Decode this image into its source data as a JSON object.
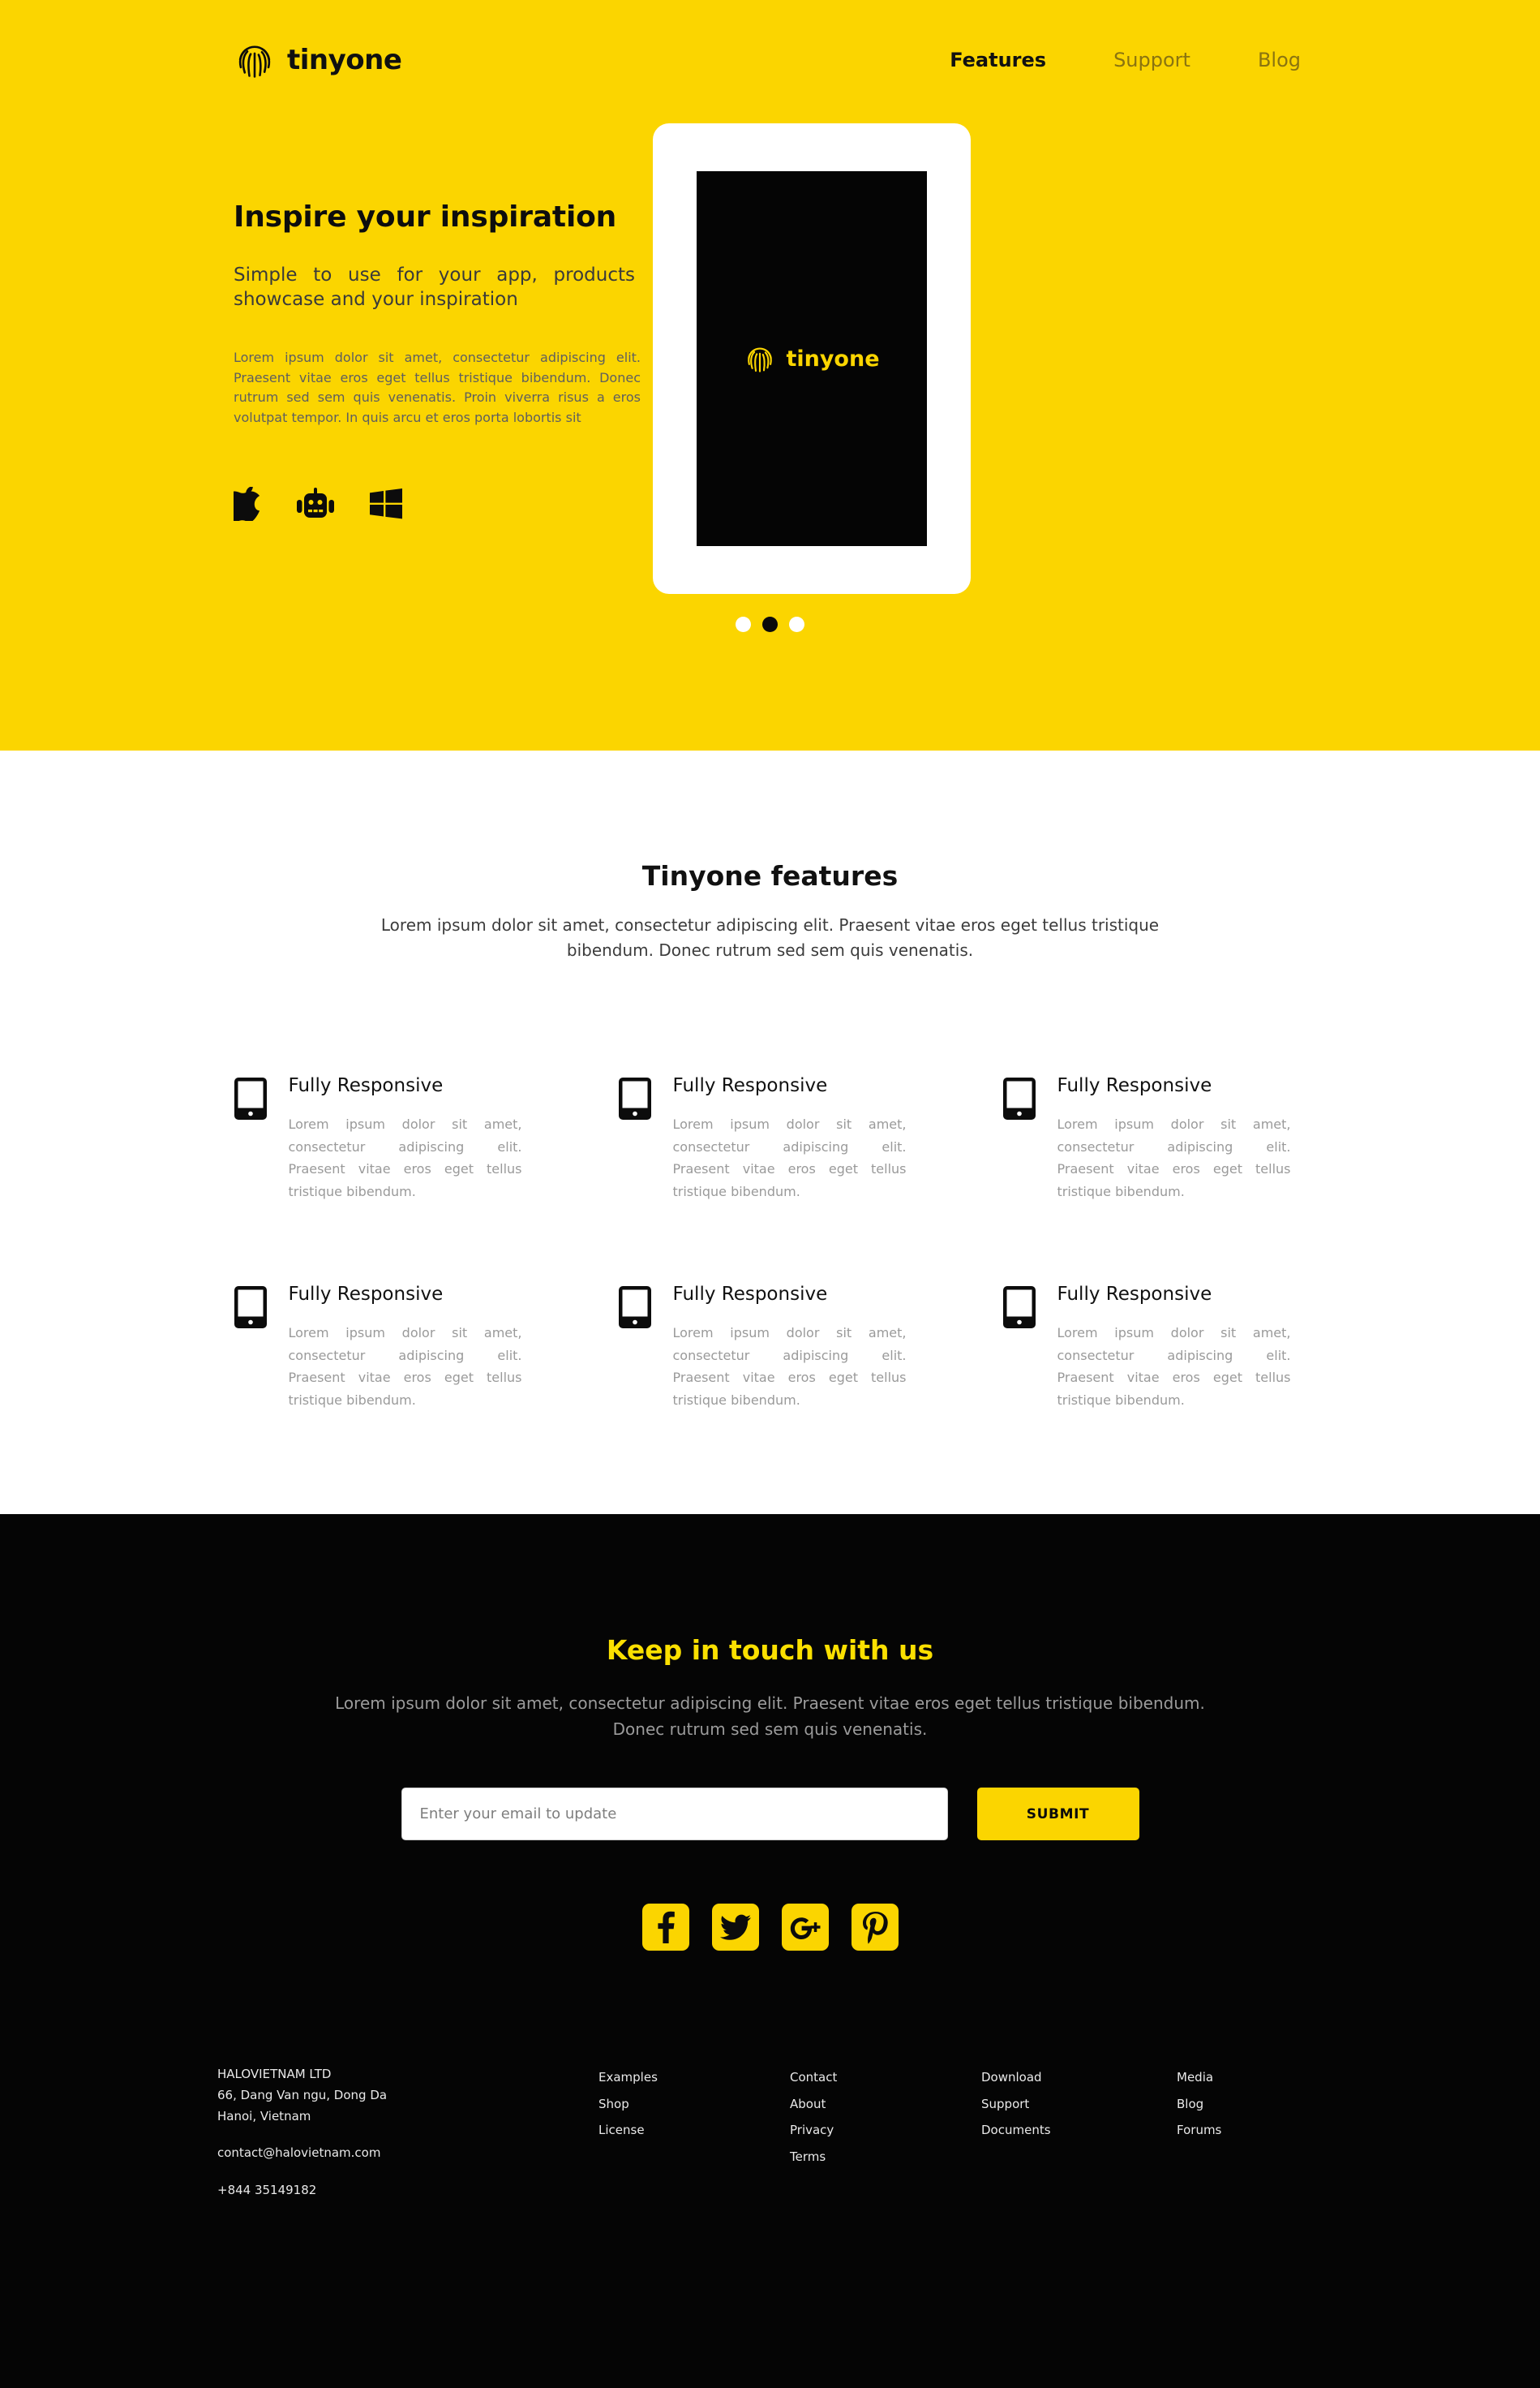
{
  "brand": {
    "name": "tinyone",
    "logo_icon": "fingerprint-icon",
    "accent_color": "#fbd500",
    "dark_color": "#050505"
  },
  "nav": {
    "items": [
      {
        "label": "Features",
        "active": true
      },
      {
        "label": "Support",
        "active": false
      },
      {
        "label": "Blog",
        "active": false
      }
    ]
  },
  "hero": {
    "title": "Inspire your inspiration",
    "subtitle": "Simple to use for your app, products showcase and your inspiration",
    "description": "Lorem ipsum dolor sit amet, consectetur adipiscing elit. Praesent vitae eros eget tellus tristique bibendum. Donec rutrum sed sem quis venenatis. Proin viverra risus a eros volutpat tempor. In quis arcu et eros porta lobortis sit",
    "platforms": [
      {
        "name": "apple-icon",
        "label": "Apple"
      },
      {
        "name": "android-icon",
        "label": "Android"
      },
      {
        "name": "windows-icon",
        "label": "Windows"
      }
    ],
    "device": {
      "screen_logo_text": "tinyone",
      "screen_background": "#050505",
      "frame_color": "#ffffff"
    },
    "carousel": {
      "dots": [
        {
          "active": false
        },
        {
          "active": true
        },
        {
          "active": false
        }
      ]
    }
  },
  "features": {
    "title": "Tinyone features",
    "subtitle": "Lorem ipsum dolor sit amet, consectetur adipiscing elit. Praesent vitae eros eget tellus tristique bibendum. Donec rutrum sed sem quis venenatis.",
    "items": [
      {
        "icon": "tablet-icon",
        "title": "Fully Responsive",
        "text": "Lorem ipsum dolor sit amet, consectetur adipiscing elit. Praesent vitae eros eget tellus tristique bibendum."
      },
      {
        "icon": "tablet-icon",
        "title": "Fully Responsive",
        "text": "Lorem ipsum dolor sit amet, consectetur adipiscing elit. Praesent vitae eros eget tellus tristique bibendum."
      },
      {
        "icon": "tablet-icon",
        "title": "Fully Responsive",
        "text": "Lorem ipsum dolor sit amet, consectetur adipiscing elit. Praesent vitae eros eget tellus tristique bibendum."
      },
      {
        "icon": "tablet-icon",
        "title": "Fully Responsive",
        "text": "Lorem ipsum dolor sit amet, consectetur adipiscing elit. Praesent vitae eros eget tellus tristique bibendum."
      },
      {
        "icon": "tablet-icon",
        "title": "Fully Responsive",
        "text": "Lorem ipsum dolor sit amet, consectetur adipiscing elit. Praesent vitae eros eget tellus tristique bibendum."
      },
      {
        "icon": "tablet-icon",
        "title": "Fully Responsive",
        "text": "Lorem ipsum dolor sit amet, consectetur adipiscing elit. Praesent vitae eros eget tellus tristique bibendum."
      }
    ]
  },
  "contact": {
    "title": "Keep in touch with us",
    "subtitle": "Lorem ipsum dolor sit amet, consectetur adipiscing elit. Praesent vitae eros eget tellus tristique bibendum. Donec rutrum sed sem quis venenatis.",
    "email_placeholder": "Enter your email to update",
    "email_value": "",
    "submit_label": "SUBMIT",
    "socials": [
      {
        "name": "facebook-icon",
        "label": "Facebook"
      },
      {
        "name": "twitter-icon",
        "label": "Twitter"
      },
      {
        "name": "google-plus-icon",
        "label": "Google Plus"
      },
      {
        "name": "pinterest-icon",
        "label": "Pinterest"
      }
    ]
  },
  "footer": {
    "company": {
      "name": "HALOVIETNAM LTD",
      "address_line1": "66, Dang Van ngu, Dong Da",
      "address_line2": "Hanoi, Vietnam",
      "email": "contact@halovietnam.com",
      "phone": "+844 35149182"
    },
    "columns": [
      {
        "links": [
          {
            "label": "Examples"
          },
          {
            "label": "Shop"
          },
          {
            "label": "License"
          }
        ]
      },
      {
        "links": [
          {
            "label": "Contact"
          },
          {
            "label": "About"
          },
          {
            "label": "Privacy"
          },
          {
            "label": "Terms"
          }
        ]
      },
      {
        "links": [
          {
            "label": "Download"
          },
          {
            "label": "Support"
          },
          {
            "label": "Documents"
          }
        ]
      },
      {
        "links": [
          {
            "label": "Media"
          },
          {
            "label": "Blog"
          },
          {
            "label": "Forums"
          }
        ]
      }
    ]
  }
}
